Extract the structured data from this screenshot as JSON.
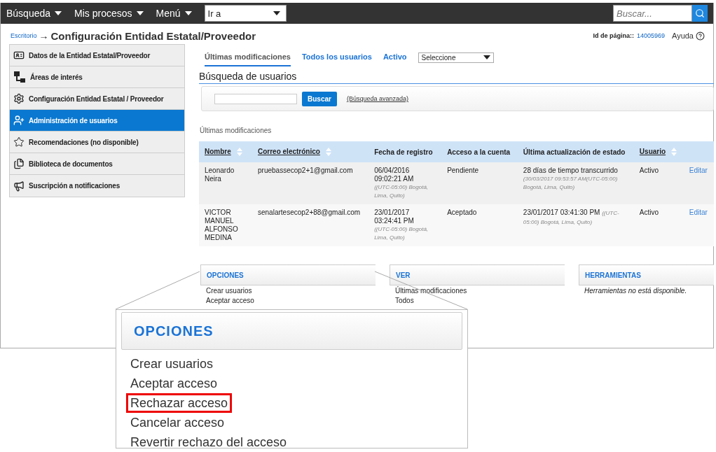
{
  "topbar": {
    "menus": [
      {
        "label": "Búsqueda"
      },
      {
        "label": "Mis procesos"
      },
      {
        "label": "Menú"
      }
    ],
    "goto": {
      "value": "Ir a"
    },
    "search": {
      "placeholder": "Buscar..."
    }
  },
  "breadcrumb": {
    "link": "Escritorio",
    "arrow": "→",
    "title": "Configuración Entidad Estatal/Proveedor",
    "page_id_label": "Id de página::",
    "page_id": "14005969",
    "help": "Ayuda"
  },
  "sidebar": {
    "items": [
      {
        "label": "Datos de la Entidad Estatal/Proveedor",
        "kind": "card",
        "selected": false
      },
      {
        "label": "Áreas de interés",
        "kind": "tree",
        "selected": false
      },
      {
        "label": "Configuración Entidad Estatal / Proveedor",
        "kind": "gears",
        "selected": false
      },
      {
        "label": "Administración de usuarios",
        "kind": "user",
        "selected": true
      },
      {
        "label": "Recomendaciones (no disponible)",
        "kind": "star",
        "selected": false
      },
      {
        "label": "Biblioteca de documentos",
        "kind": "docs",
        "selected": false
      },
      {
        "label": "Suscripción a notificaciones",
        "kind": "megaphone",
        "selected": false
      }
    ]
  },
  "tabs": [
    {
      "label": "Últimas modificaciones",
      "selected": true
    },
    {
      "label": "Todos los usuarios",
      "selected": false
    },
    {
      "label": "Activo",
      "selected": false
    }
  ],
  "filter": {
    "value": "Seleccione"
  },
  "search_section": {
    "title": "Búsqueda de usuarios",
    "button": "Buscar",
    "advanced": "(Búsqueda avanzada)"
  },
  "list_caption": "Últimas modificaciones",
  "table": {
    "columns": [
      {
        "label": "Nombre",
        "sortable": true
      },
      {
        "label": "Correo electrónico",
        "sortable": true
      },
      {
        "label": "Fecha de registro",
        "sortable": false
      },
      {
        "label": "Acceso a la cuenta",
        "sortable": false
      },
      {
        "label": "Última actualización de estado",
        "sortable": false
      },
      {
        "label": "Usuario",
        "sortable": true
      }
    ],
    "rows": [
      {
        "name": "Leonardo Neira",
        "email": "pruebassecop2+1@gmail.com",
        "date": "06/04/2016",
        "time": "09:02:21 AM",
        "timezone": "((UTC-05:00) Bogotá, Lima, Quito)",
        "access": "Pendiente",
        "status": "28 días de tiempo transcurrido",
        "status_note": "(30/03/2017 09:53:57 AM(UTC-05:00) Bogotá, Lima, Quito)",
        "note_inline": false,
        "user": "Activo",
        "action": "Editar"
      },
      {
        "name": "VICTOR MANUEL ALFONSO MEDINA",
        "email": "senalartesecop2+88@gmail.com",
        "date": "23/01/2017",
        "time": "03:24:41 PM",
        "timezone": "((UTC-05:00) Bogotá, Lima, Quito)",
        "access": "Aceptado",
        "status": "23/01/2017 03:41:30 PM",
        "status_note": "((UTC-05:00) Bogotá, Lima, Quito)",
        "note_inline": true,
        "user": "Activo",
        "action": "Editar"
      }
    ]
  },
  "panels": [
    {
      "title": "OPCIONES",
      "items": [
        "Crear usuarios",
        "Aceptar acceso"
      ],
      "kind": "links"
    },
    {
      "title": "VER",
      "items": [
        "Últimas modificaciones",
        "Todos"
      ],
      "kind": "links"
    },
    {
      "title": "HERRAMIENTAS",
      "items": [
        "Herramientas no está disponible."
      ],
      "kind": "note"
    }
  ],
  "callout": {
    "title": "OPCIONES",
    "items": [
      {
        "label": "Crear usuarios",
        "highlighted": false
      },
      {
        "label": "Aceptar acceso",
        "highlighted": false
      },
      {
        "label": "Rechazar acceso",
        "highlighted": true
      },
      {
        "label": "Cancelar acceso",
        "highlighted": false
      },
      {
        "label": "Revertir rechazo del acceso",
        "highlighted": false
      }
    ]
  }
}
